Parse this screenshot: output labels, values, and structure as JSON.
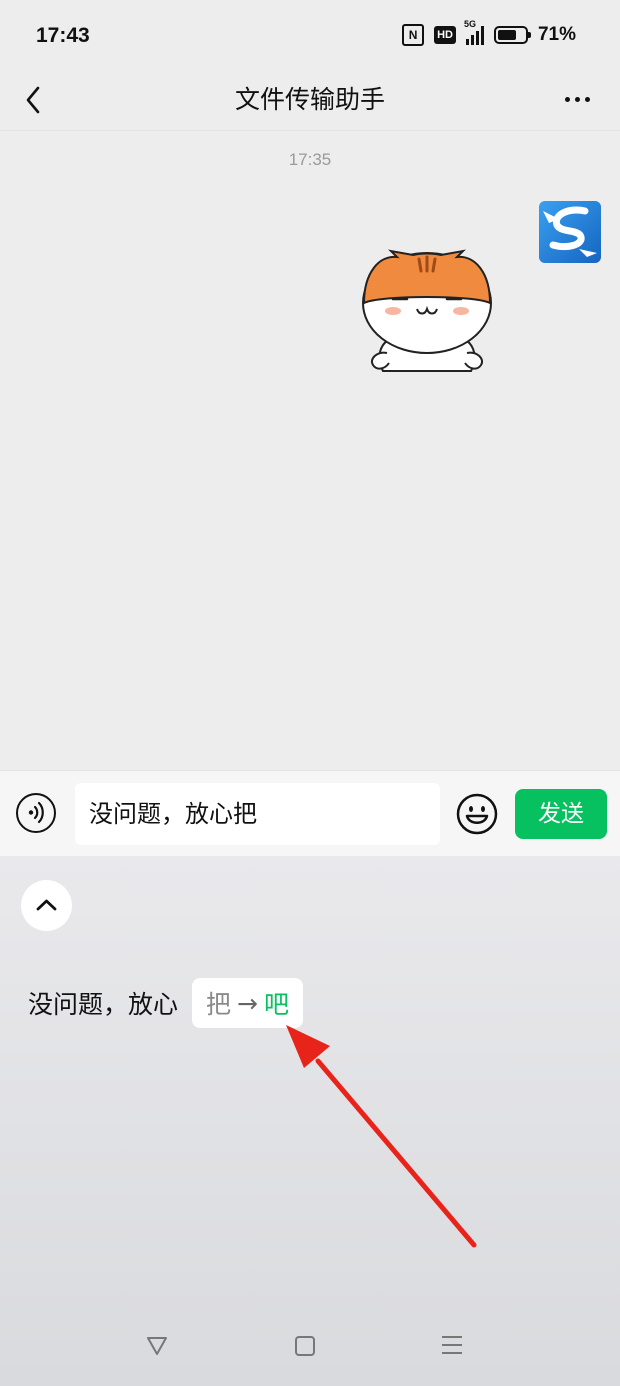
{
  "status_bar": {
    "time": "17:43",
    "nfc": "N",
    "hd": "HD",
    "network": "5G",
    "battery": "71%",
    "battery_level": 0.71
  },
  "header": {
    "title": "文件传输助手"
  },
  "chat": {
    "timestamp": "17:35"
  },
  "input": {
    "text": "没问题，放心把",
    "send_label": "发送"
  },
  "correction": {
    "prefix": "没问题，放心",
    "original": "把",
    "arrow": "→",
    "suggestion": "吧"
  },
  "colors": {
    "accent": "#07c160",
    "annotation": "#e8231a",
    "background": "#ededed"
  },
  "icons": [
    "back-icon",
    "more-icon",
    "voice-icon",
    "emoji-icon",
    "chevron-up-icon",
    "nav-back-icon",
    "nav-home-icon",
    "nav-menu-icon"
  ]
}
